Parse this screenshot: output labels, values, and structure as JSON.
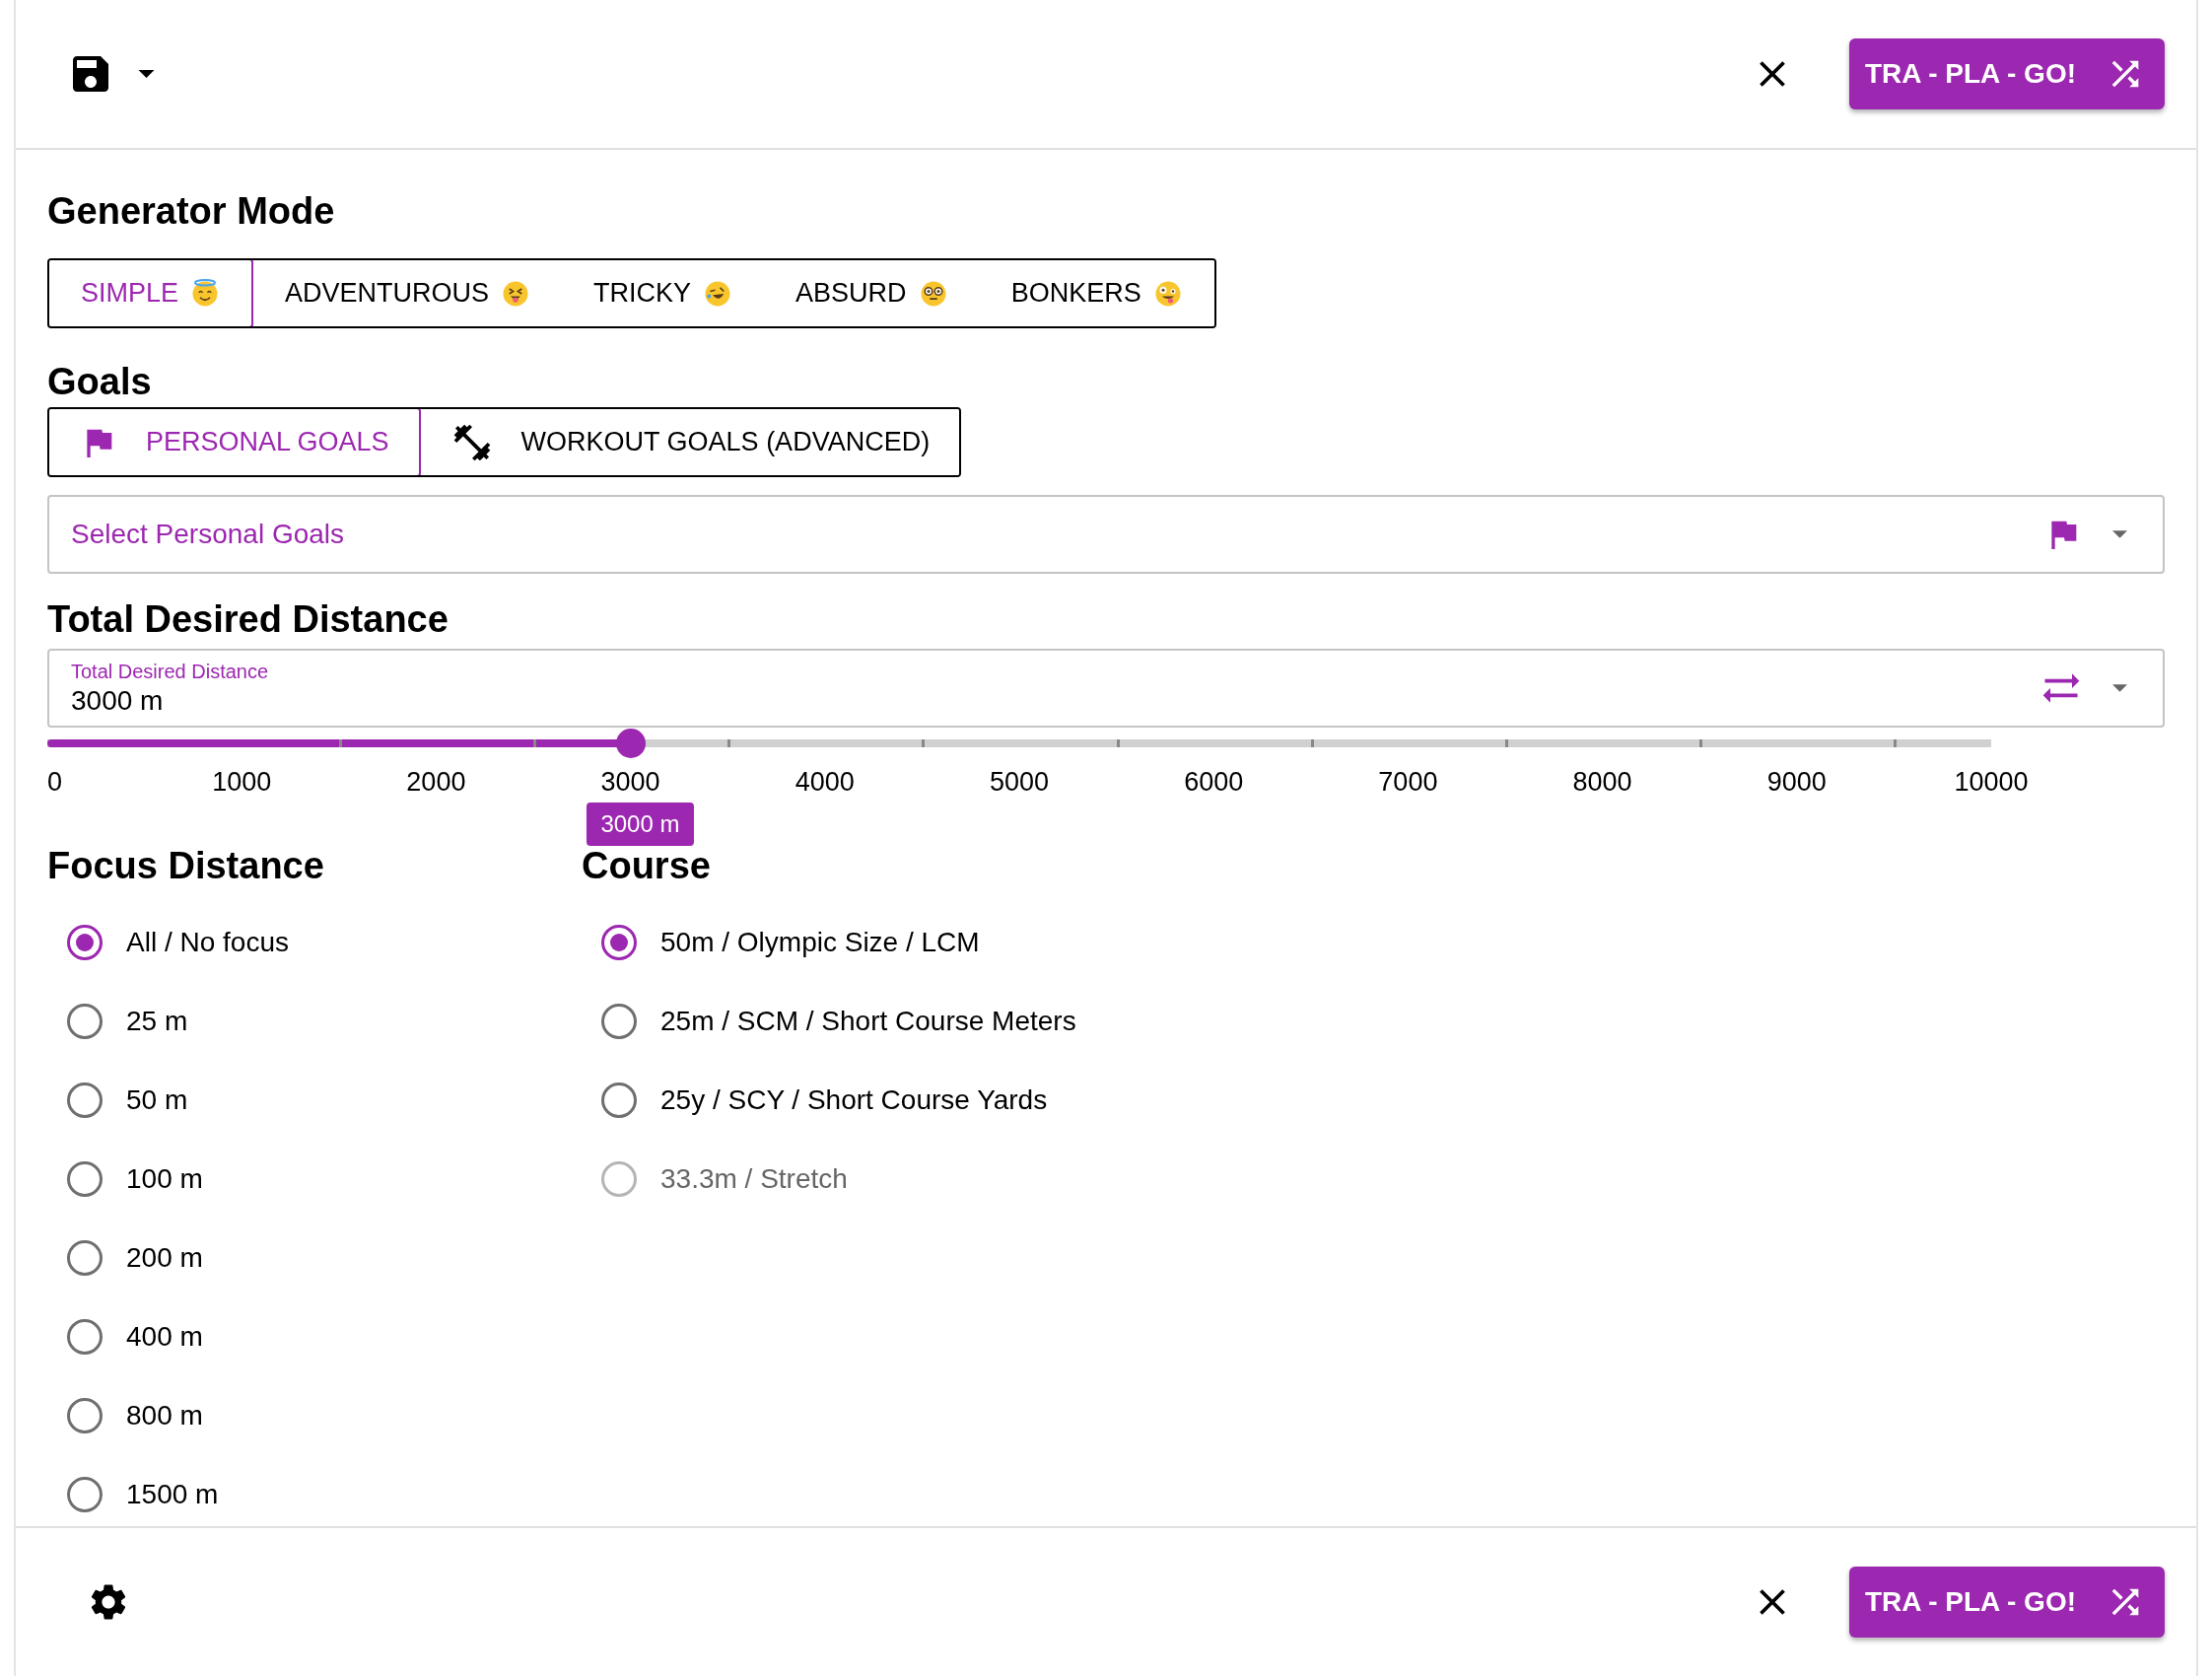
{
  "top_bar": {
    "go_button": "TRA - PLA - GO!"
  },
  "generator_mode": {
    "title": "Generator Mode",
    "tabs": [
      {
        "label": "SIMPLE",
        "kind": "halo",
        "selected": true
      },
      {
        "label": "ADVENTUROUS",
        "kind": "tongue",
        "selected": false
      },
      {
        "label": "TRICKY",
        "kind": "laughing",
        "selected": false
      },
      {
        "label": "ABSURD",
        "kind": "monocle",
        "selected": false
      },
      {
        "label": "BONKERS",
        "kind": "zany",
        "selected": false
      }
    ]
  },
  "goals": {
    "title": "Goals",
    "tabs": [
      {
        "label": "PERSONAL GOALS",
        "kind": "flag",
        "selected": true
      },
      {
        "label": "WORKOUT GOALS (ADVANCED)",
        "kind": "dumbbell",
        "selected": false
      }
    ],
    "select": {
      "placeholder": "Select Personal Goals"
    }
  },
  "distance": {
    "title": "Total Desired Distance",
    "field": {
      "label": "Total Desired Distance",
      "value": "3000 m"
    },
    "slider": {
      "level": 0.3,
      "tooltip": "3000 m",
      "ticks": [
        "0",
        "1000",
        "2000",
        "3000",
        "4000",
        "5000",
        "6000",
        "7000",
        "8000",
        "9000",
        "10000"
      ]
    }
  },
  "focus": {
    "title": "Focus Distance",
    "options": [
      {
        "label": "All / No focus",
        "selected": true
      },
      {
        "label": "25 m",
        "selected": false
      },
      {
        "label": "50 m",
        "selected": false
      },
      {
        "label": "100 m",
        "selected": false
      },
      {
        "label": "200 m",
        "selected": false
      },
      {
        "label": "400 m",
        "selected": false
      },
      {
        "label": "800 m",
        "selected": false
      },
      {
        "label": "1500 m",
        "selected": false
      }
    ]
  },
  "course": {
    "title": "Course",
    "options": [
      {
        "label": "50m / Olympic Size / LCM",
        "selected": true,
        "disabled": false
      },
      {
        "label": "25m / SCM / Short Course Meters",
        "selected": false,
        "disabled": false
      },
      {
        "label": "25y / SCY / Short Course Yards",
        "selected": false,
        "disabled": false
      },
      {
        "label": "33.3m / Stretch",
        "selected": false,
        "disabled": true
      }
    ]
  },
  "bottom_bar": {
    "go_button": "TRA - PLA - GO!"
  }
}
